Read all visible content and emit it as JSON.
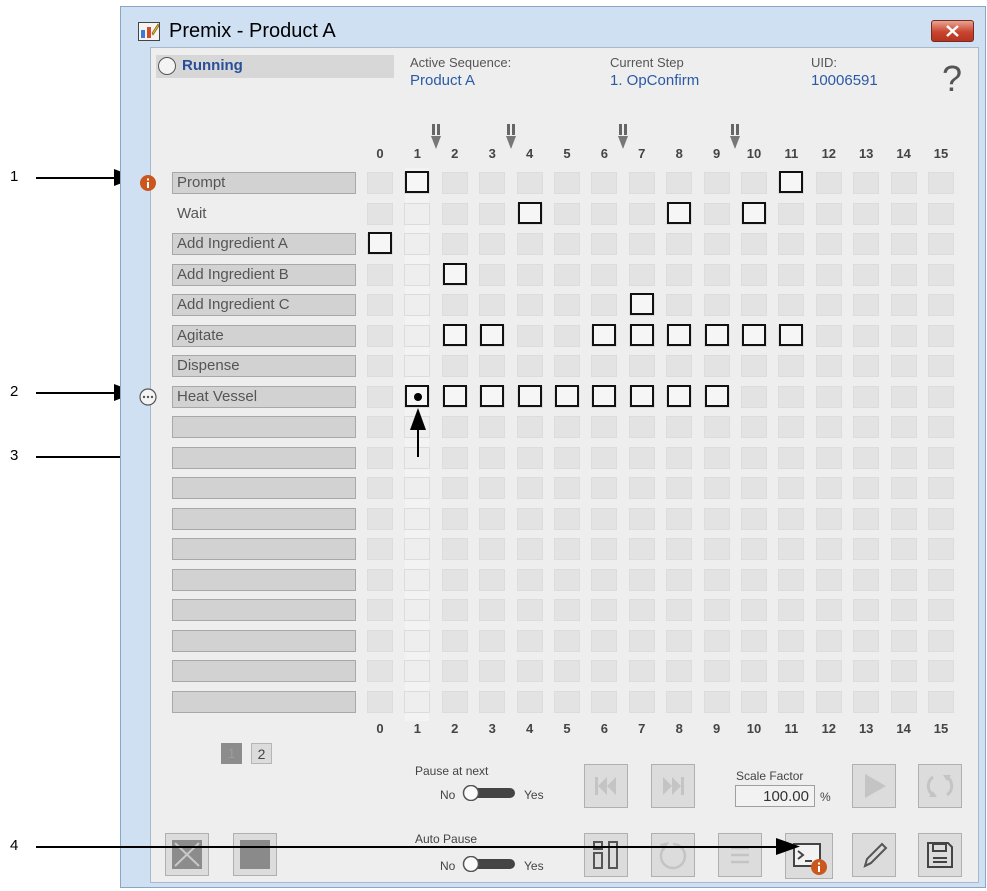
{
  "window": {
    "title": "Premix - Product A",
    "status": "Running",
    "active_sequence_label": "Active Sequence:",
    "active_sequence": "Product A",
    "current_step_label": "Current Step",
    "current_step": "1. OpConfirm",
    "uid_label": "UID:",
    "uid": "10006591",
    "help_glyph": "?"
  },
  "columns": [
    "0",
    "1",
    "2",
    "3",
    "4",
    "5",
    "6",
    "7",
    "8",
    "9",
    "10",
    "11",
    "12",
    "13",
    "14",
    "15"
  ],
  "steps": [
    {
      "label": "Prompt",
      "boxed": true,
      "icon": "info-icon"
    },
    {
      "label": "Wait",
      "boxed": false
    },
    {
      "label": "Add Ingredient A",
      "boxed": true
    },
    {
      "label": "Add Ingredient B",
      "boxed": true
    },
    {
      "label": "Add Ingredient C",
      "boxed": true
    },
    {
      "label": "Agitate",
      "boxed": true
    },
    {
      "label": "Dispense",
      "boxed": true
    },
    {
      "label": "Heat Vessel",
      "boxed": true,
      "icon": "ellipsis-icon"
    },
    {
      "label": "",
      "boxed": true
    },
    {
      "label": "",
      "boxed": true
    },
    {
      "label": "",
      "boxed": true
    },
    {
      "label": "",
      "boxed": true
    },
    {
      "label": "",
      "boxed": true
    },
    {
      "label": "",
      "boxed": true
    },
    {
      "label": "",
      "boxed": true
    },
    {
      "label": "",
      "boxed": true
    },
    {
      "label": "",
      "boxed": true
    },
    {
      "label": "",
      "boxed": true
    }
  ],
  "selections": [
    {
      "row": 0,
      "col": 1
    },
    {
      "row": 0,
      "col": 11
    },
    {
      "row": 1,
      "col": 4
    },
    {
      "row": 1,
      "col": 8
    },
    {
      "row": 1,
      "col": 10
    },
    {
      "row": 2,
      "col": 0
    },
    {
      "row": 3,
      "col": 2
    },
    {
      "row": 4,
      "col": 7
    },
    {
      "row": 5,
      "col": 2
    },
    {
      "row": 5,
      "col": 3
    },
    {
      "row": 5,
      "col": 6
    },
    {
      "row": 5,
      "col": 7
    },
    {
      "row": 5,
      "col": 8
    },
    {
      "row": 5,
      "col": 9
    },
    {
      "row": 5,
      "col": 10
    },
    {
      "row": 5,
      "col": 11
    },
    {
      "row": 7,
      "col": 1,
      "active": true
    },
    {
      "row": 7,
      "col": 2
    },
    {
      "row": 7,
      "col": 3
    },
    {
      "row": 7,
      "col": 4
    },
    {
      "row": 7,
      "col": 5
    },
    {
      "row": 7,
      "col": 6
    },
    {
      "row": 7,
      "col": 7
    },
    {
      "row": 7,
      "col": 8
    },
    {
      "row": 7,
      "col": 9
    }
  ],
  "pause_markers_after_columns": [
    1,
    3,
    6,
    9
  ],
  "highlight_column": 1,
  "pagination": {
    "pages": [
      "1",
      "2"
    ],
    "current": "1"
  },
  "pause_at_next": {
    "label": "Pause at next",
    "off_label": "No",
    "on_label": "Yes"
  },
  "auto_pause": {
    "label": "Auto Pause",
    "off_label": "No",
    "on_label": "Yes"
  },
  "scale_factor": {
    "label": "Scale Factor",
    "value": "100.00",
    "unit": "%"
  },
  "callouts": [
    "1",
    "2",
    "3",
    "4"
  ],
  "colors": {
    "accent_blue": "#2a5aa6",
    "info_orange": "#c9571e",
    "close_red": "#c9452e"
  }
}
